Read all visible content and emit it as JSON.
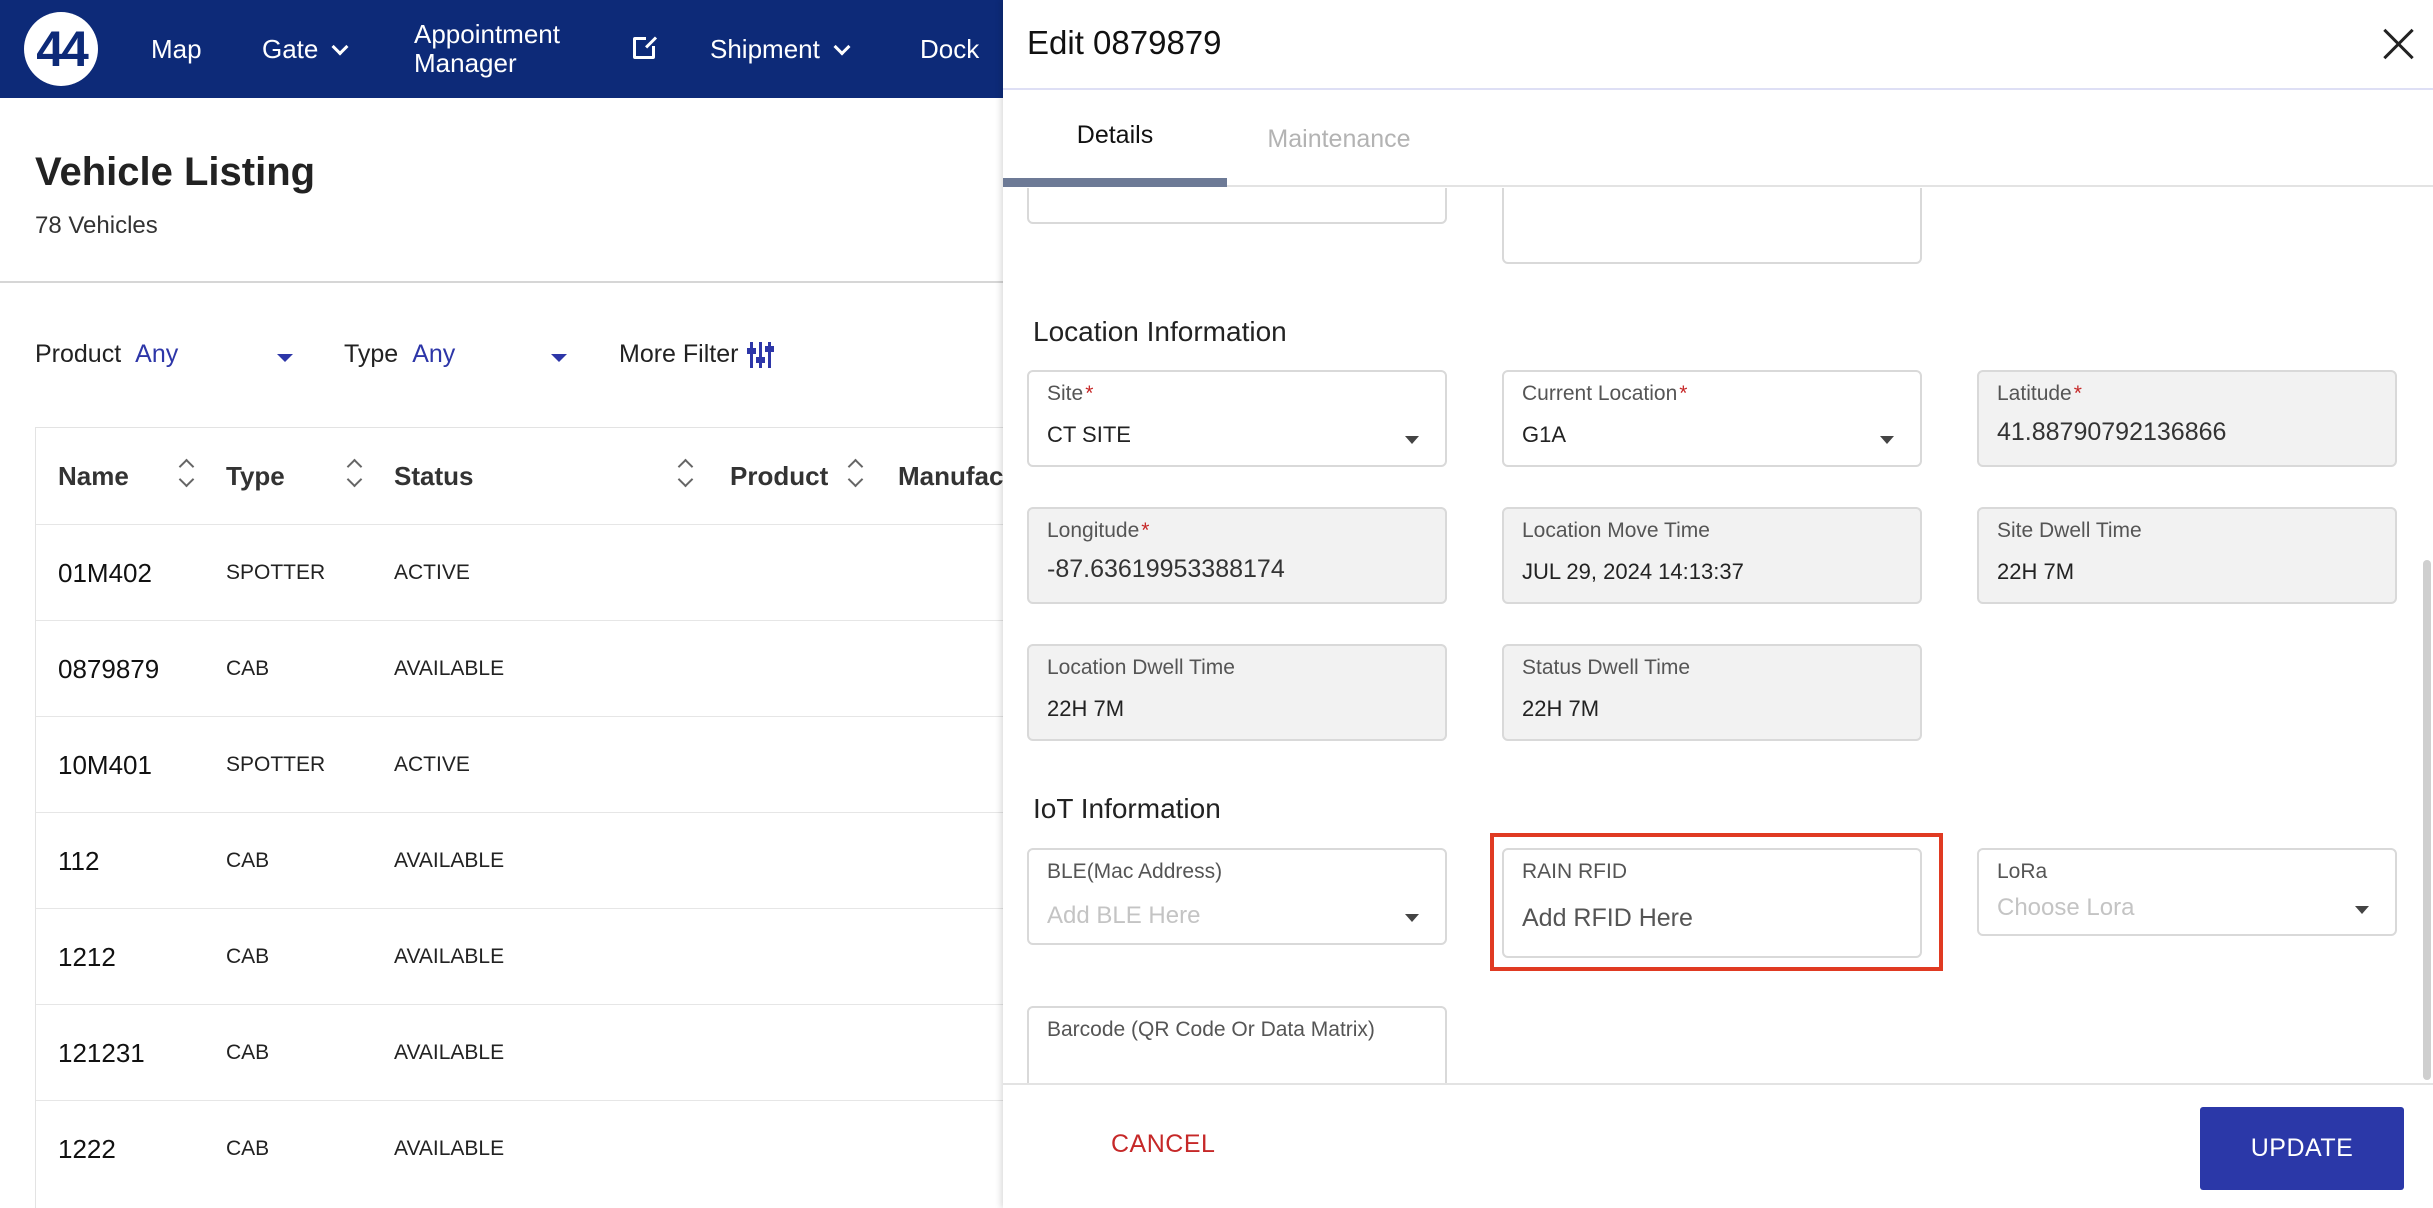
{
  "nav": {
    "logo": "44",
    "items": [
      {
        "label": "Map"
      },
      {
        "label": "Gate"
      },
      {
        "label_line1": "Appointment",
        "label_line2": "Manager"
      },
      {
        "label": "Shipment"
      },
      {
        "label": "Dock"
      }
    ]
  },
  "listing": {
    "title": "Vehicle Listing",
    "count": "78 Vehicles",
    "filters": {
      "product_label": "Product",
      "product_value": "Any",
      "type_label": "Type",
      "type_value": "Any",
      "more_filter": "More Filter"
    },
    "columns": [
      "Name",
      "Type",
      "Status",
      "Product",
      "Manufact"
    ],
    "rows": [
      {
        "name": "01M402",
        "type": "SPOTTER",
        "status": "ACTIVE"
      },
      {
        "name": "0879879",
        "type": "CAB",
        "status": "AVAILABLE"
      },
      {
        "name": "10M401",
        "type": "SPOTTER",
        "status": "ACTIVE"
      },
      {
        "name": "112",
        "type": "CAB",
        "status": "AVAILABLE"
      },
      {
        "name": "1212",
        "type": "CAB",
        "status": "AVAILABLE"
      },
      {
        "name": "121231",
        "type": "CAB",
        "status": "AVAILABLE"
      },
      {
        "name": "1222",
        "type": "CAB",
        "status": "AVAILABLE"
      }
    ]
  },
  "drawer": {
    "title": "Edit 0879879",
    "tabs": [
      "Details",
      "Maintenance"
    ],
    "location_section": "Location Information",
    "fields": {
      "site": {
        "label": "Site",
        "value": "CT SITE"
      },
      "current_location": {
        "label": "Current Location",
        "value": "G1A"
      },
      "latitude": {
        "label": "Latitude",
        "value": "41.88790792136866"
      },
      "longitude": {
        "label": "Longitude",
        "value": "-87.63619953388174"
      },
      "location_move_time": {
        "label": "Location Move Time",
        "value": "JUL 29, 2024 14:13:37"
      },
      "site_dwell_time": {
        "label": "Site Dwell Time",
        "value": "22H 7M"
      },
      "location_dwell_time": {
        "label": "Location Dwell Time",
        "value": "22H 7M"
      },
      "status_dwell_time": {
        "label": "Status Dwell Time",
        "value": "22H 7M"
      }
    },
    "iot_section": "IoT Information",
    "iot": {
      "ble": {
        "label": "BLE(Mac Address)",
        "placeholder": "Add BLE Here"
      },
      "rfid": {
        "label": "RAIN RFID",
        "placeholder": "Add RFID Here"
      },
      "lora": {
        "label": "LoRa",
        "placeholder": "Choose Lora"
      },
      "barcode": {
        "label": "Barcode (QR Code Or Data Matrix)"
      }
    },
    "required_mark": "*",
    "cancel": "CANCEL",
    "update": "UPDATE"
  },
  "colors": {
    "nav_bg": "#0d2a78",
    "accent": "#2b38a8",
    "cancel_text": "#c62828",
    "highlight": "#e03a22"
  }
}
